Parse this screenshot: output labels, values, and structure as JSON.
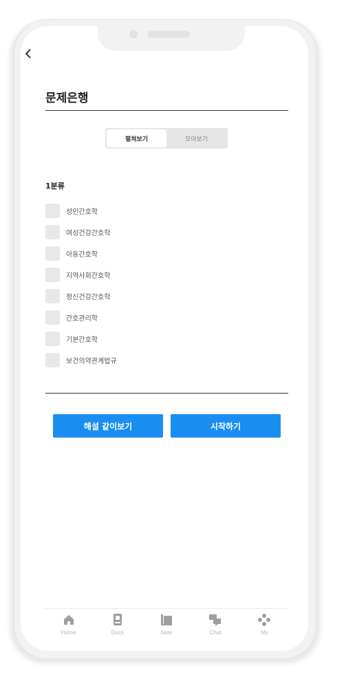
{
  "header": {
    "title": "문제은행"
  },
  "view_toggle": {
    "options": [
      "펼쳐보기",
      "모아보기"
    ],
    "selected": "펼쳐보기"
  },
  "category_section": {
    "label": "1분류",
    "items": [
      "성인간호학",
      "여성건강간호학",
      "아동간호학",
      "지역사회간호학",
      "정신건강간호학",
      "간호관리학",
      "기본간호학",
      "보건의약관계법규"
    ]
  },
  "actions": {
    "explain_label": "해설 같이보기",
    "start_label": "시작하기"
  },
  "tabbar": {
    "items": [
      {
        "label": "Home",
        "icon": "home-icon"
      },
      {
        "label": "Docs",
        "icon": "docs-icon"
      },
      {
        "label": "Note",
        "icon": "note-icon"
      },
      {
        "label": "Chat",
        "icon": "chat-icon"
      },
      {
        "label": "My",
        "icon": "my-icon"
      }
    ]
  },
  "colors": {
    "accent": "#1a8df0",
    "checkbox": "#e8e8e8",
    "tab_icon": "#9e9e9e"
  }
}
